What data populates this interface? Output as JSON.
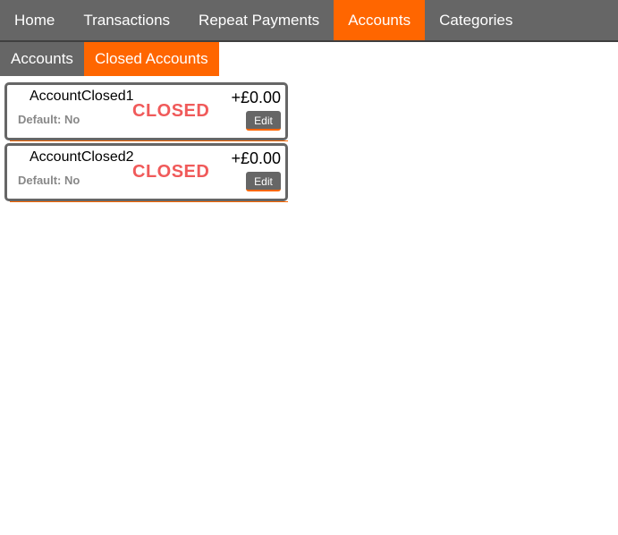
{
  "topnav": {
    "items": [
      {
        "label": "Home",
        "active": false
      },
      {
        "label": "Transactions",
        "active": false
      },
      {
        "label": "Repeat Payments",
        "active": false
      },
      {
        "label": "Accounts",
        "active": true
      },
      {
        "label": "Categories",
        "active": false
      }
    ]
  },
  "subnav": {
    "items": [
      {
        "label": "Accounts",
        "active": false
      },
      {
        "label": "Closed Accounts",
        "active": true
      }
    ]
  },
  "accounts": [
    {
      "name": "AccountClosed1",
      "default_text": "Default: No",
      "status": "CLOSED",
      "balance": "+£0.00",
      "edit_label": "Edit"
    },
    {
      "name": "AccountClosed2",
      "default_text": "Default: No",
      "status": "CLOSED",
      "balance": "+£0.00",
      "edit_label": "Edit"
    }
  ],
  "colors": {
    "accent": "#ff6600",
    "nav_bg": "#666666",
    "closed_status": "#f05a5a"
  }
}
